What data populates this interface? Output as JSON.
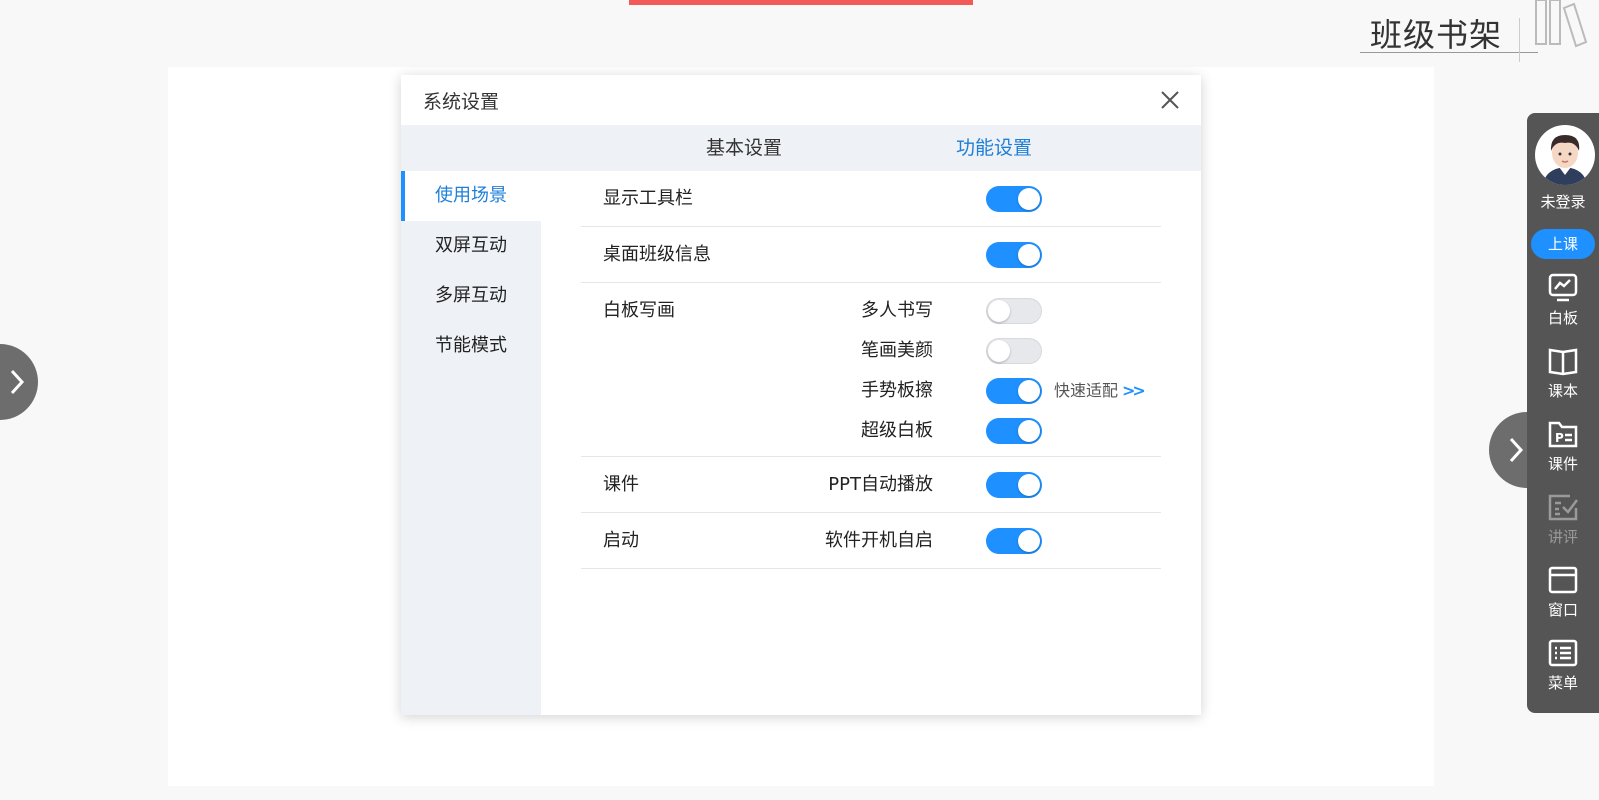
{
  "shelf": {
    "title": "班级书架"
  },
  "dialog": {
    "title": "系统设置",
    "tabs": [
      "基本设置",
      "功能设置"
    ],
    "nav": [
      "使用场景",
      "双屏互动",
      "多屏互动",
      "节能模式"
    ],
    "rows": {
      "toolbar": {
        "label": "显示工具栏",
        "on": true
      },
      "desktop_info": {
        "label": "桌面班级信息",
        "on": true
      },
      "whiteboard": {
        "label": "白板写画",
        "items": [
          {
            "label": "多人书写",
            "on": false
          },
          {
            "label": "笔画美颜",
            "on": false
          },
          {
            "label": "手势板擦",
            "on": true,
            "link": "快速适配"
          },
          {
            "label": "超级白板",
            "on": true
          }
        ]
      },
      "courseware": {
        "label": "课件",
        "sub": "PPT自动播放",
        "on": true
      },
      "startup": {
        "label": "启动",
        "sub": "软件开机自启",
        "on": true
      }
    }
  },
  "sidebar": {
    "login": "未登录",
    "class_button": "上课",
    "tools": [
      {
        "label": "白板",
        "icon": "whiteboard-icon"
      },
      {
        "label": "课本",
        "icon": "book-icon"
      },
      {
        "label": "课件",
        "icon": "courseware-icon"
      },
      {
        "label": "讲评",
        "icon": "review-icon"
      },
      {
        "label": "窗口",
        "icon": "window-icon"
      },
      {
        "label": "菜单",
        "icon": "menu-icon"
      }
    ]
  },
  "colors": {
    "accent": "#1e90ff",
    "active_text": "#1e7fd8",
    "toolbar_bg": "#555555",
    "top_bar": "#f25959"
  }
}
